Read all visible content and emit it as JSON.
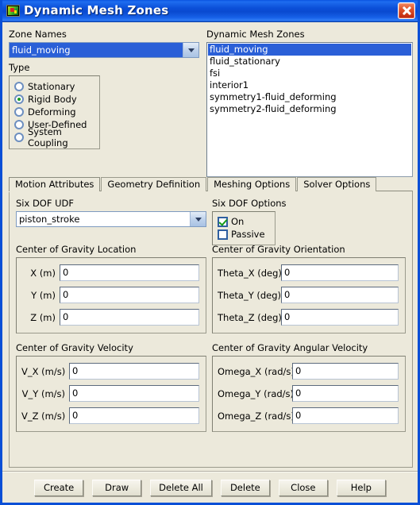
{
  "window": {
    "title": "Dynamic Mesh Zones",
    "icon": "mesh-icon",
    "close_label": "×",
    "accent_titlebar": "#0b4fd8",
    "background": "#ece9db",
    "selection_color": "#2a5fd7"
  },
  "zone_names": {
    "label": "Zone Names",
    "selected": "fluid_moving"
  },
  "type": {
    "label": "Type",
    "options": [
      {
        "label": "Stationary",
        "selected": false
      },
      {
        "label": "Rigid Body",
        "selected": true
      },
      {
        "label": "Deforming",
        "selected": false
      },
      {
        "label": "User-Defined",
        "selected": false
      },
      {
        "label": "System Coupling",
        "selected": false
      }
    ]
  },
  "zone_list": {
    "label": "Dynamic Mesh Zones",
    "items": [
      {
        "name": "fluid_moving",
        "selected": true
      },
      {
        "name": "fluid_stationary",
        "selected": false
      },
      {
        "name": "fsi",
        "selected": false
      },
      {
        "name": "interior1",
        "selected": false
      },
      {
        "name": "symmetry1-fluid_deforming",
        "selected": false
      },
      {
        "name": "symmetry2-fluid_deforming",
        "selected": false
      }
    ]
  },
  "tabs": [
    {
      "label": "Motion Attributes",
      "active": true
    },
    {
      "label": "Geometry Definition",
      "active": false
    },
    {
      "label": "Meshing Options",
      "active": false
    },
    {
      "label": "Solver Options",
      "active": false
    }
  ],
  "motion_attributes": {
    "six_dof_udf": {
      "label": "Six DOF UDF",
      "selected": "piston_stroke"
    },
    "six_dof_options": {
      "label": "Six DOF Options",
      "options": [
        {
          "label": "On",
          "checked": true
        },
        {
          "label": "Passive",
          "checked": false
        }
      ]
    },
    "cg_location": {
      "label": "Center of Gravity Location",
      "fields": [
        {
          "label": "X (m)",
          "value": "0"
        },
        {
          "label": "Y (m)",
          "value": "0"
        },
        {
          "label": "Z (m)",
          "value": "0"
        }
      ]
    },
    "cg_orientation": {
      "label": "Center of Gravity Orientation",
      "fields": [
        {
          "label": "Theta_X (deg)",
          "value": "0"
        },
        {
          "label": "Theta_Y (deg)",
          "value": "0"
        },
        {
          "label": "Theta_Z (deg)",
          "value": "0"
        }
      ]
    },
    "cg_velocity": {
      "label": "Center of Gravity Velocity",
      "fields": [
        {
          "label": "V_X (m/s)",
          "value": "0"
        },
        {
          "label": "V_Y (m/s)",
          "value": "0"
        },
        {
          "label": "V_Z (m/s)",
          "value": "0"
        }
      ]
    },
    "cg_angular_velocity": {
      "label": "Center of Gravity Angular Velocity",
      "fields": [
        {
          "label": "Omega_X (rad/s)",
          "value": "0"
        },
        {
          "label": "Omega_Y (rad/s)",
          "value": "0"
        },
        {
          "label": "Omega_Z (rad/s)",
          "value": "0"
        }
      ]
    }
  },
  "buttons": [
    {
      "label": "Create"
    },
    {
      "label": "Draw"
    },
    {
      "label": "Delete All"
    },
    {
      "label": "Delete"
    },
    {
      "label": "Close"
    },
    {
      "label": "Help"
    }
  ]
}
